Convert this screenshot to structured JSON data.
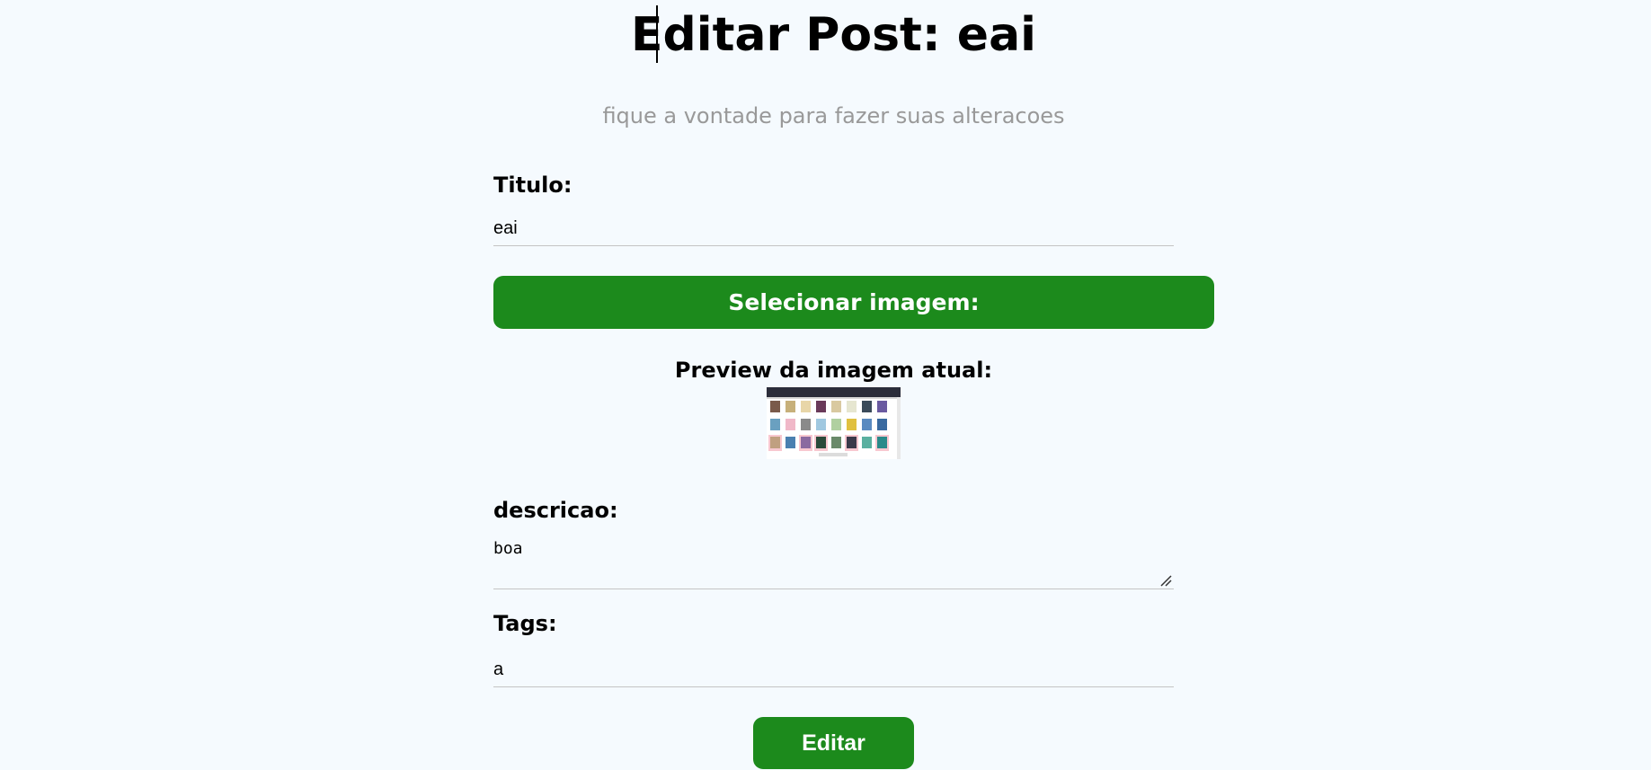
{
  "header": {
    "title": "Editar Post: eai",
    "subtitle": "fique a vontade para fazer suas alteracoes"
  },
  "form": {
    "titulo_label": "Titulo:",
    "titulo_value": "eai",
    "select_image_label": "Selecionar imagem:",
    "preview_label": "Preview da imagem atual:",
    "descricao_label": "descricao:",
    "descricao_value": "boa",
    "tags_label": "Tags:",
    "tags_value": "a",
    "submit_label": "Editar"
  },
  "colors": {
    "background": "#f5fafe",
    "primary_button": "#1c8a1c",
    "subtitle_text": "#999999",
    "field_border": "#c4c4c4"
  }
}
